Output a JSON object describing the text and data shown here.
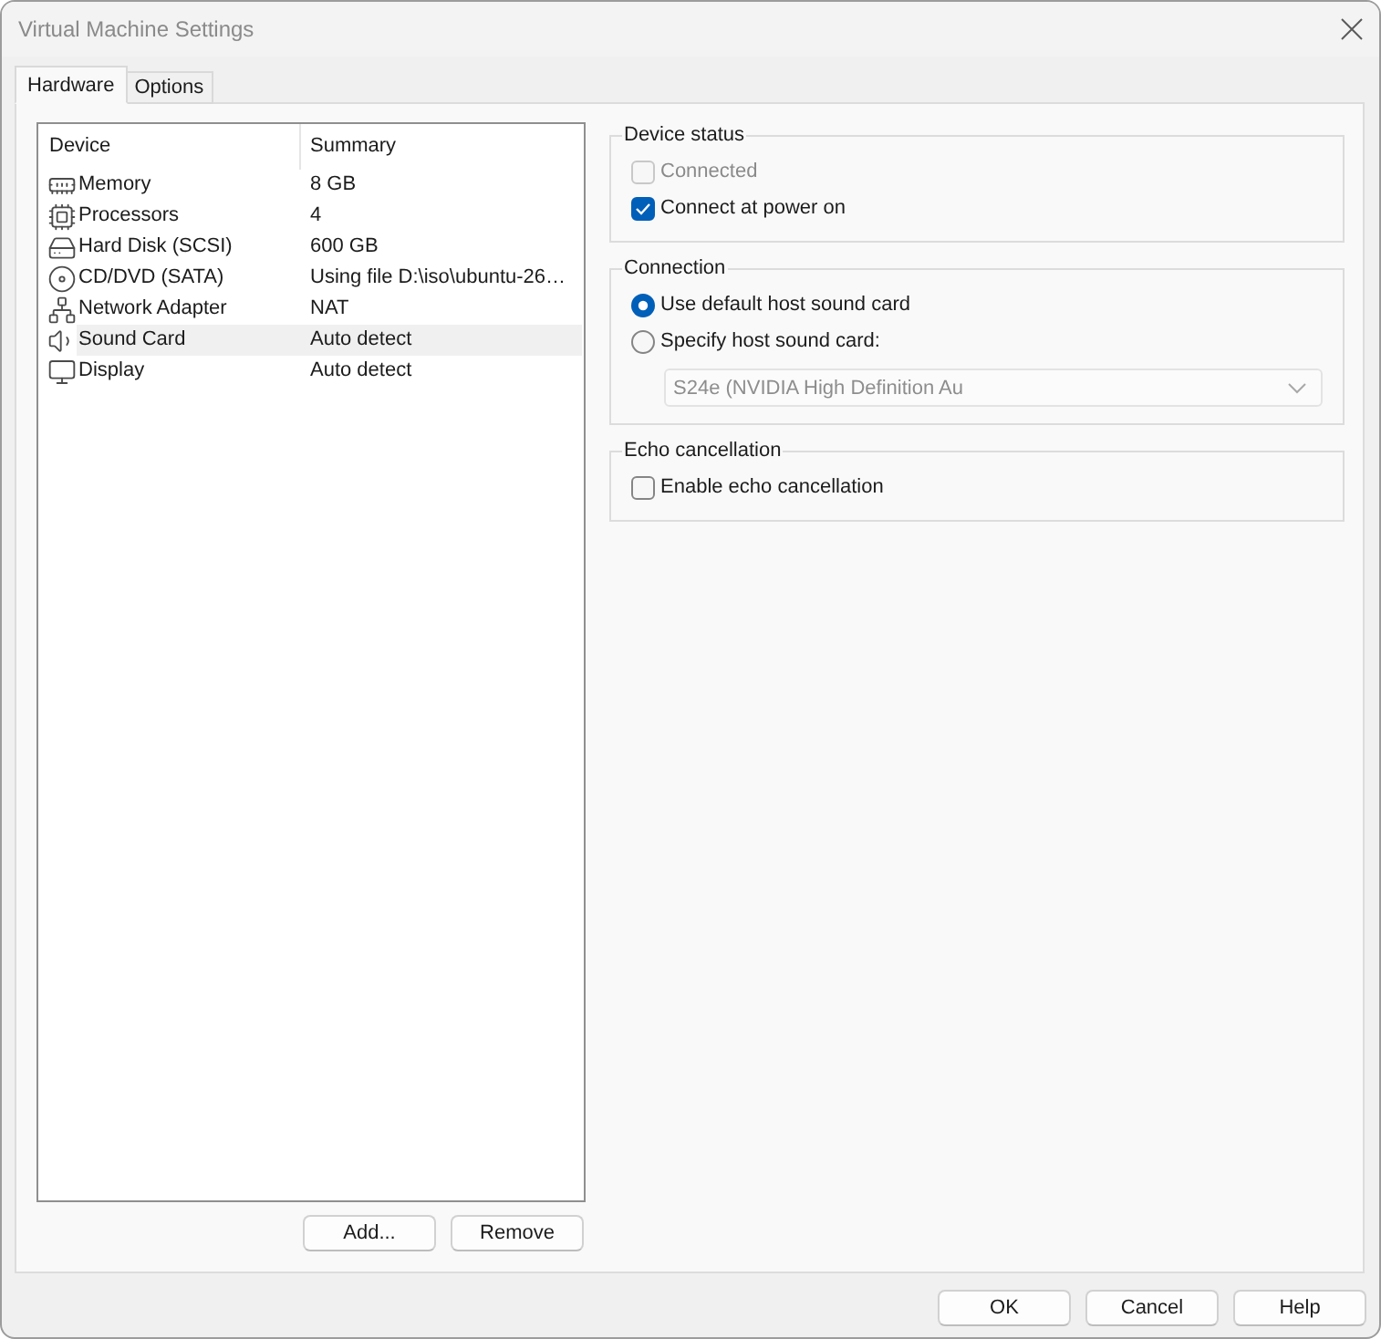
{
  "window": {
    "title": "Virtual Machine Settings"
  },
  "tabs": [
    {
      "label": "Hardware",
      "selected": true
    },
    {
      "label": "Options",
      "selected": false
    }
  ],
  "device_list": {
    "columns": [
      "Device",
      "Summary"
    ],
    "rows": [
      {
        "kind": "memory",
        "device": "Memory",
        "summary": "8 GB",
        "selected": false
      },
      {
        "kind": "processor",
        "device": "Processors",
        "summary": "4",
        "selected": false
      },
      {
        "kind": "hard_disk",
        "device": "Hard Disk (SCSI)",
        "summary": "600 GB",
        "selected": false
      },
      {
        "kind": "cd_dvd",
        "device": "CD/DVD (SATA)",
        "summary": "Using file D:\\iso\\ubuntu-26…",
        "selected": false
      },
      {
        "kind": "network",
        "device": "Network Adapter",
        "summary": "NAT",
        "selected": false
      },
      {
        "kind": "sound",
        "device": "Sound Card",
        "summary": "Auto detect",
        "selected": true
      },
      {
        "kind": "display",
        "device": "Display",
        "summary": "Auto detect",
        "selected": false
      }
    ]
  },
  "list_buttons": [
    "Add...",
    "Remove"
  ],
  "device_status": {
    "title": "Device status",
    "options": [
      {
        "label": "Connected",
        "checked": false,
        "disabled": true
      },
      {
        "label": "Connect at power on",
        "checked": true,
        "disabled": false
      }
    ]
  },
  "connection": {
    "title": "Connection",
    "options": [
      {
        "label": "Use default host sound card",
        "selected": true
      },
      {
        "label": "Specify host sound card:",
        "selected": false
      }
    ],
    "dropdown": {
      "value": "S24e (NVIDIA High Definition Au",
      "disabled": true
    }
  },
  "echo_cancellation": {
    "title": "Echo cancellation",
    "options": [
      {
        "label": "Enable echo cancellation",
        "checked": false,
        "disabled": false
      }
    ]
  },
  "buttons": [
    "OK",
    "Cancel",
    "Help"
  ]
}
